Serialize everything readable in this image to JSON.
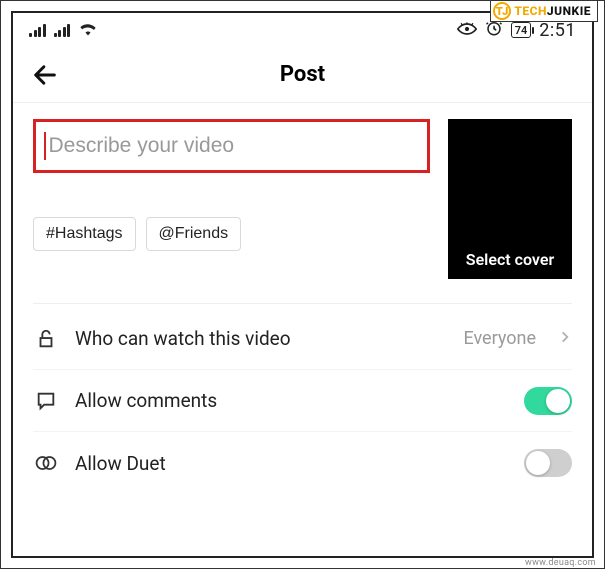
{
  "branding": {
    "tj_initials": "TJ",
    "tj_tech": "TECH",
    "tj_junkie": "JUNKIE",
    "domain": "www.deuaq.com"
  },
  "status_bar": {
    "battery": "74",
    "clock": "2:51"
  },
  "header": {
    "title": "Post"
  },
  "caption": {
    "placeholder": "Describe your video"
  },
  "chips": {
    "hashtags": "#Hashtags",
    "friends": "@Friends"
  },
  "cover": {
    "label": "Select cover"
  },
  "settings": {
    "privacy": {
      "label": "Who can watch this video",
      "value": "Everyone"
    },
    "comments": {
      "label": "Allow comments"
    },
    "duet": {
      "label": "Allow Duet"
    }
  }
}
